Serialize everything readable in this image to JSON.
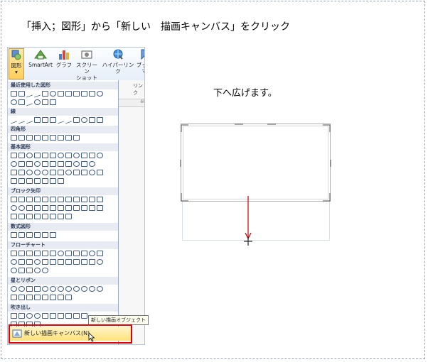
{
  "instruction": "「挿入；図形」から「新しい　描画キャンバス」をクリック",
  "note": "下へ広げます。",
  "ribbon": {
    "buttons": [
      {
        "label": "図形",
        "sub": "▾",
        "icon": "shapes-icon"
      },
      {
        "label": "SmartArt",
        "sub": "",
        "icon": "smartart-icon"
      },
      {
        "label": "グラフ",
        "sub": "",
        "icon": "chart-icon"
      },
      {
        "label": "スクリーン",
        "sub": "ショット ▾",
        "icon": "screenshot-icon"
      },
      {
        "label": "ハイパーリンク",
        "sub": "",
        "icon": "hyperlink-icon"
      },
      {
        "label": "ブックマ",
        "sub": "",
        "icon": "bookmark-icon"
      }
    ],
    "group_label": "リンク",
    "ruler_tick": "60"
  },
  "gallery": {
    "sections": [
      "最近使用した図形",
      "線",
      "四角形",
      "基本図形",
      "ブロック矢印",
      "数式図形",
      "フローチャート",
      "星とリボン",
      "吹き出し"
    ]
  },
  "tooltip": "新しい描画オブジェクト",
  "new_canvas_label": "新しい描画キャンバス(N)",
  "colors": {
    "highlight": "#e00000",
    "arrow": "#c00000",
    "frame": "#8fa6c8"
  }
}
